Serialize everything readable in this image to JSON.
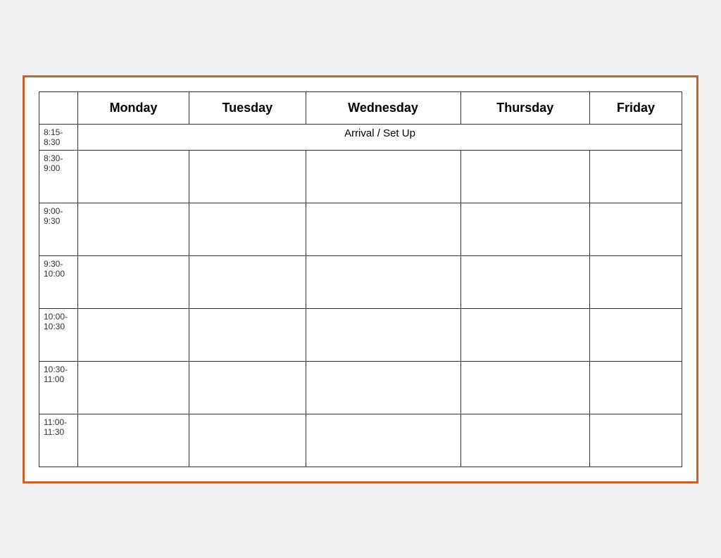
{
  "table": {
    "headers": {
      "time": "",
      "monday": "Monday",
      "tuesday": "Tuesday",
      "wednesday": "Wednesday",
      "thursday": "Thursday",
      "friday": "Friday"
    },
    "arrival_row": {
      "time": "8:15-\n8:30",
      "label": "Arrival / Set Up"
    },
    "rows": [
      {
        "time": "8:30-\n9:00"
      },
      {
        "time": "9:00-\n9:30"
      },
      {
        "time": "9:30-\n10:00"
      },
      {
        "time": "10:00-\n10:30"
      },
      {
        "time": "10:30-\n11:00"
      },
      {
        "time": "11:00-\n11:30"
      }
    ]
  }
}
